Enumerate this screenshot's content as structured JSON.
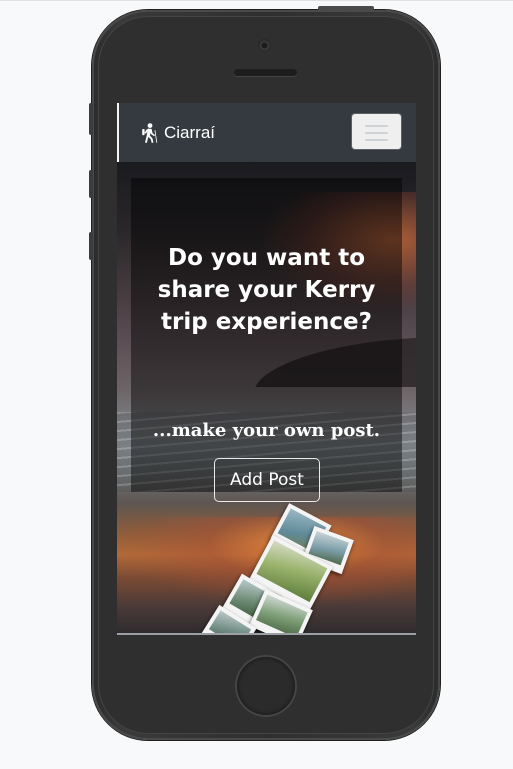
{
  "navbar": {
    "brand_name": "Ciarraí",
    "brand_icon": "hiking-icon",
    "menu_icon": "hamburger-menu-icon"
  },
  "hero": {
    "headline": "Do you want to share your Kerry trip experience?",
    "subheadline": "...make your own post.",
    "cta_label": "Add Post"
  },
  "colors": {
    "navbar_bg": "#343a40",
    "text": "#ffffff",
    "phone_body": "#2f2f2f"
  }
}
